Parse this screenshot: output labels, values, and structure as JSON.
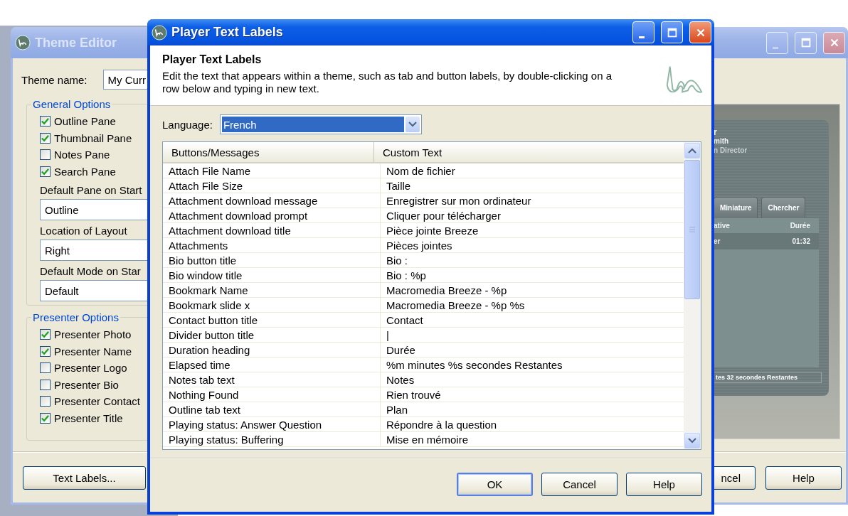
{
  "theme_editor": {
    "title": "Theme Editor",
    "theme_name_label": "Theme name:",
    "theme_name_value": "My Curr",
    "general_options": {
      "title": "General Options",
      "checkboxes": [
        {
          "label": "Outline Pane",
          "checked": true
        },
        {
          "label": "Thumbnail Pane",
          "checked": true
        },
        {
          "label": "Notes Pane",
          "checked": false
        },
        {
          "label": "Search Pane",
          "checked": true
        }
      ],
      "fields": [
        {
          "label": "Default Pane on Start",
          "value": "Outline"
        },
        {
          "label": "Location of Layout",
          "value": "Right"
        },
        {
          "label": "Default Mode on Star",
          "value": "Default"
        }
      ]
    },
    "presenter_options": {
      "title": "Presenter Options",
      "checkboxes": [
        {
          "label": "Presenter Photo",
          "checked": true
        },
        {
          "label": "Presenter Name",
          "checked": true
        },
        {
          "label": "Presenter Logo",
          "checked": false
        },
        {
          "label": "Presenter Bio",
          "checked": false
        },
        {
          "label": "Presenter Contact",
          "checked": false
        },
        {
          "label": "Presenter Title",
          "checked": true
        }
      ]
    },
    "preview": {
      "name": "r",
      "presenter": "mith",
      "role": "n Director",
      "tabs": [
        "Miniature",
        "Chercher"
      ],
      "list_header": [
        "ative",
        "Durée"
      ],
      "list_rows": [
        {
          "title": "er",
          "duration": "01:32",
          "selected": true
        }
      ],
      "status": "tes 32 secondes Restantes"
    },
    "text_labels_button": "Text Labels...",
    "buttons": [
      "ncel",
      "Help"
    ]
  },
  "dialog": {
    "title": "Player Text Labels",
    "heading": "Player Text Labels",
    "description": "Edit the text that appears within a theme, such as tab and button labels, by double-clicking on a row below and typing in new text.",
    "language_label": "Language:",
    "language_value": "French",
    "columns": [
      "Buttons/Messages",
      "Custom Text"
    ],
    "rows": [
      {
        "message": "Attach File Name",
        "custom_text": "Nom de fichier"
      },
      {
        "message": "Attach File Size",
        "custom_text": "Taille"
      },
      {
        "message": "Attachment download message",
        "custom_text": "Enregistrer sur mon ordinateur"
      },
      {
        "message": "Attachment download prompt",
        "custom_text": "Cliquer pour télécharger"
      },
      {
        "message": "Attachment download title",
        "custom_text": "Pièce jointe Breeze"
      },
      {
        "message": "Attachments",
        "custom_text": "Pièces jointes"
      },
      {
        "message": "Bio button title",
        "custom_text": "Bio :"
      },
      {
        "message": "Bio window title",
        "custom_text": "Bio : %p"
      },
      {
        "message": "Bookmark Name",
        "custom_text": "Macromedia Breeze - %p"
      },
      {
        "message": "Bookmark slide x",
        "custom_text": "Macromedia Breeze - %p %s"
      },
      {
        "message": "Contact button title",
        "custom_text": "Contact"
      },
      {
        "message": "Divider button title",
        "custom_text": "|"
      },
      {
        "message": "Duration heading",
        "custom_text": "Durée"
      },
      {
        "message": "Elapsed time",
        "custom_text": "%m minutes %s secondes Restantes"
      },
      {
        "message": "Notes tab text",
        "custom_text": "Notes"
      },
      {
        "message": "Nothing Found",
        "custom_text": "Rien trouvé"
      },
      {
        "message": "Outline tab text",
        "custom_text": "Plan"
      },
      {
        "message": "Playing status: Answer Question",
        "custom_text": "Répondre à la question"
      },
      {
        "message": "Playing status: Buffering",
        "custom_text": "Mise en mémoire"
      }
    ],
    "buttons": [
      {
        "label": "OK",
        "default": true
      },
      {
        "label": "Cancel",
        "default": false
      },
      {
        "label": "Help",
        "default": false
      }
    ]
  }
}
